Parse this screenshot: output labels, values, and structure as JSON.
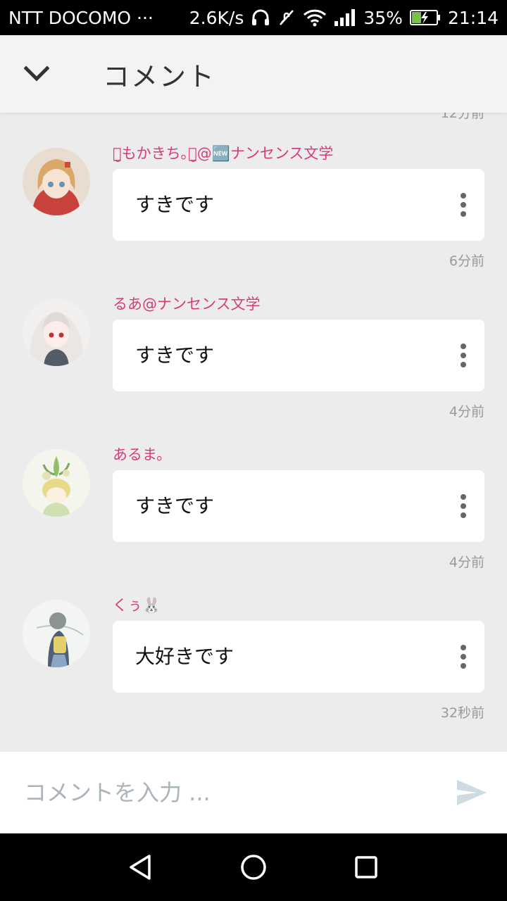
{
  "status_bar": {
    "carrier": "NTT DOCOMO ···",
    "speed": "2.6K/s",
    "battery": "35%",
    "time": "21:14"
  },
  "header": {
    "title": "コメント"
  },
  "comments": [
    {
      "user": "ꪔ̤̮もかきち｡ꪔ̤̮@🆕ナンセンス文学",
      "text": "すきです",
      "time": "6分前"
    },
    {
      "user": "るあ@ナンセンス文学",
      "text": "すきです",
      "time": "4分前"
    },
    {
      "user": "あるま。",
      "text": "すきです",
      "time": "4分前"
    },
    {
      "user": "くぅ🐰",
      "text": "大好きです",
      "time": "32秒前"
    }
  ],
  "input": {
    "placeholder": "コメントを入力 ..."
  },
  "colors": {
    "username": "#d63c7a",
    "send_icon": "#cfdbe2"
  }
}
